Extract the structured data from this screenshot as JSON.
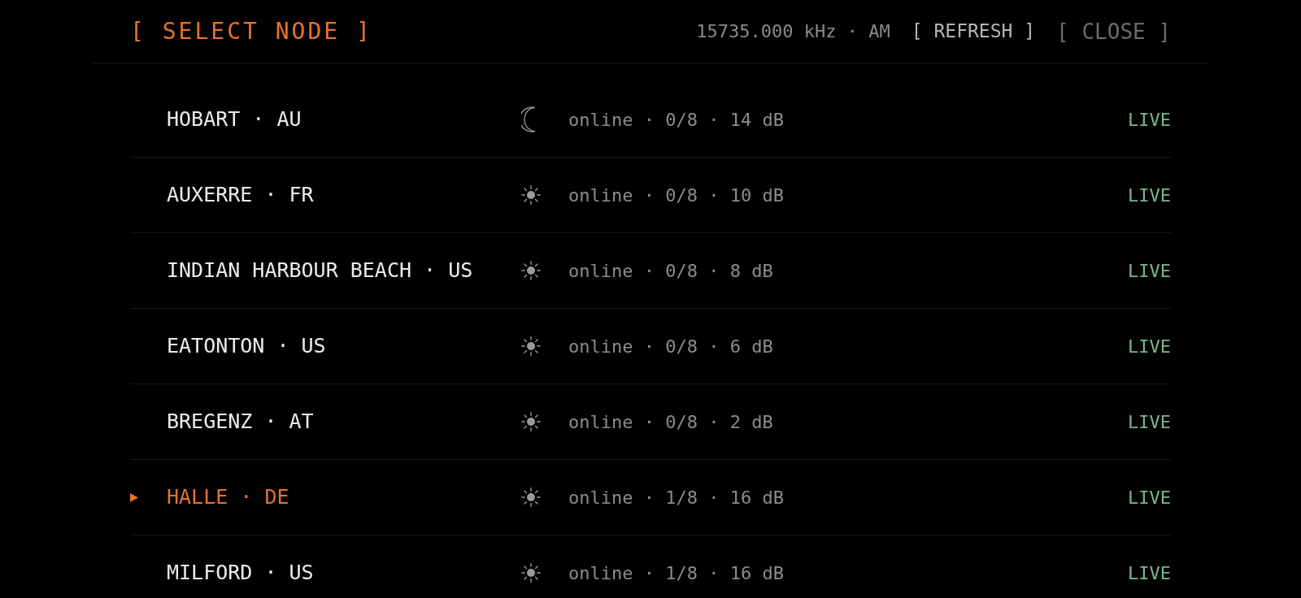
{
  "header": {
    "title": "[ SELECT NODE ]",
    "frequency": "15735.000 kHz · AM",
    "buttons": [
      {
        "label": "[ REFRESH ]",
        "kind": "action"
      },
      {
        "label": "[ CLOSE ]",
        "kind": "close"
      }
    ]
  },
  "nodes": [
    {
      "name": "HOBART · AU",
      "night": true,
      "status": "online · 0/8 · 14 dB",
      "badge": "LIVE",
      "selected": false
    },
    {
      "name": "AUXERRE · FR",
      "night": false,
      "status": "online · 0/8 · 10 dB",
      "badge": "LIVE",
      "selected": false
    },
    {
      "name": "INDIAN HARBOUR BEACH · US",
      "night": false,
      "status": "online · 0/8 · 8 dB",
      "badge": "LIVE",
      "selected": false
    },
    {
      "name": "EATONTON · US",
      "night": false,
      "status": "online · 0/8 · 6 dB",
      "badge": "LIVE",
      "selected": false
    },
    {
      "name": "BREGENZ · AT",
      "night": false,
      "status": "online · 0/8 · 2 dB",
      "badge": "LIVE",
      "selected": false
    },
    {
      "name": "HALLE · DE",
      "night": false,
      "status": "online · 1/8 · 16 dB",
      "badge": "LIVE",
      "selected": true
    },
    {
      "name": "MILFORD · US",
      "night": false,
      "status": "online · 1/8 · 16 dB",
      "badge": "LIVE",
      "selected": false
    }
  ]
}
